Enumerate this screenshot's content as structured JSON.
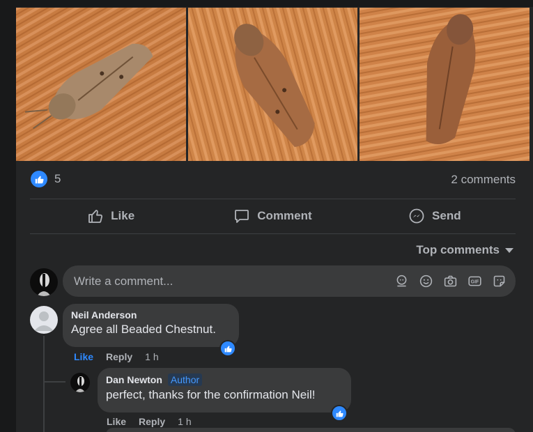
{
  "post": {
    "photos": [
      {
        "subject": "moth photo 1"
      },
      {
        "subject": "moth photo 2"
      },
      {
        "subject": "moth photo 3"
      }
    ],
    "reaction_count": "5",
    "comments_count_label": "2 comments"
  },
  "actions": {
    "like": "Like",
    "comment": "Comment",
    "send": "Send"
  },
  "sort_label": "Top comments",
  "composer": {
    "placeholder": "Write a comment...",
    "icons": [
      "avatar-sticker-icon",
      "emoji-icon",
      "camera-icon",
      "gif-icon",
      "sticker-icon"
    ]
  },
  "comments": [
    {
      "author": "Neil Anderson",
      "text": "Agree all Beaded Chestnut.",
      "like": "Like",
      "reply": "Reply",
      "time": "1 h",
      "replies": [
        {
          "author": "Dan Newton",
          "author_badge": "Author",
          "text": "perfect, thanks for the confirmation Neil!",
          "like": "Like",
          "reply": "Reply",
          "time": "1 h"
        }
      ]
    }
  ],
  "colors": {
    "background": "#242526",
    "bubble": "#3a3b3c",
    "accent": "#2e89ff",
    "secondary_text": "#b0b3b8"
  }
}
